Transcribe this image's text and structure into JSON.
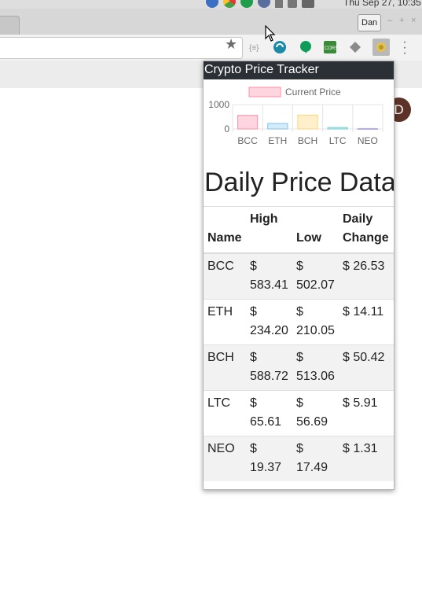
{
  "os_bar": {
    "clock": "Thu Sep 27, 10:35",
    "icons": [
      "bluetooth-icon",
      "chrome-icon",
      "hangouts-icon",
      "shield-icon",
      "network-icon",
      "volume-icon",
      "mail-icon"
    ]
  },
  "browser": {
    "profile_label": "Dan",
    "window_controls": [
      "–",
      "+",
      "×"
    ],
    "extensions": [
      "json-viewer-icon",
      "sync-icon",
      "hangouts-icon",
      "cors-icon",
      "layers-icon",
      "crypto-tracker-icon"
    ]
  },
  "page": {
    "avatar_initial": "D"
  },
  "popup": {
    "header": "Crypto Price Tracker",
    "title": "Daily Price Data",
    "legend_label": "Current Price",
    "table": {
      "headers": {
        "name": "Name",
        "high": "High",
        "low": "Low",
        "change": "Daily Change"
      },
      "rows": [
        {
          "name": "BCC",
          "high": "$ 583.41",
          "low": "$ 502.07",
          "change": "$ 26.53"
        },
        {
          "name": "ETH",
          "high": "$ 234.20",
          "low": "$ 210.05",
          "change": "$ 14.11"
        },
        {
          "name": "BCH",
          "high": "$ 588.72",
          "low": "$ 513.06",
          "change": "$ 50.42"
        },
        {
          "name": "LTC",
          "high": "$ 65.61",
          "low": "$ 56.69",
          "change": "$ 5.91"
        },
        {
          "name": "NEO",
          "high": "$ 19.37",
          "low": "$ 17.49",
          "change": "$ 1.31"
        }
      ]
    }
  },
  "chart_data": {
    "type": "bar",
    "categories": [
      "BCC",
      "ETH",
      "BCH",
      "LTC",
      "NEO"
    ],
    "series": [
      {
        "name": "Current Price",
        "values": [
          560,
          225,
          570,
          60,
          18
        ]
      }
    ],
    "yticks": [
      "1000",
      "0"
    ],
    "ylim": [
      0,
      1000
    ],
    "legend_position": "top",
    "colors": {
      "fills": [
        "#ffd6df",
        "#d4ebfa",
        "#fff0cc",
        "#d1efef",
        "#e8e0ff"
      ],
      "strokes": [
        "#ff8fa6",
        "#7ec3ef",
        "#ffd37a",
        "#6fcfcf",
        "#b8a6ef"
      ]
    }
  }
}
